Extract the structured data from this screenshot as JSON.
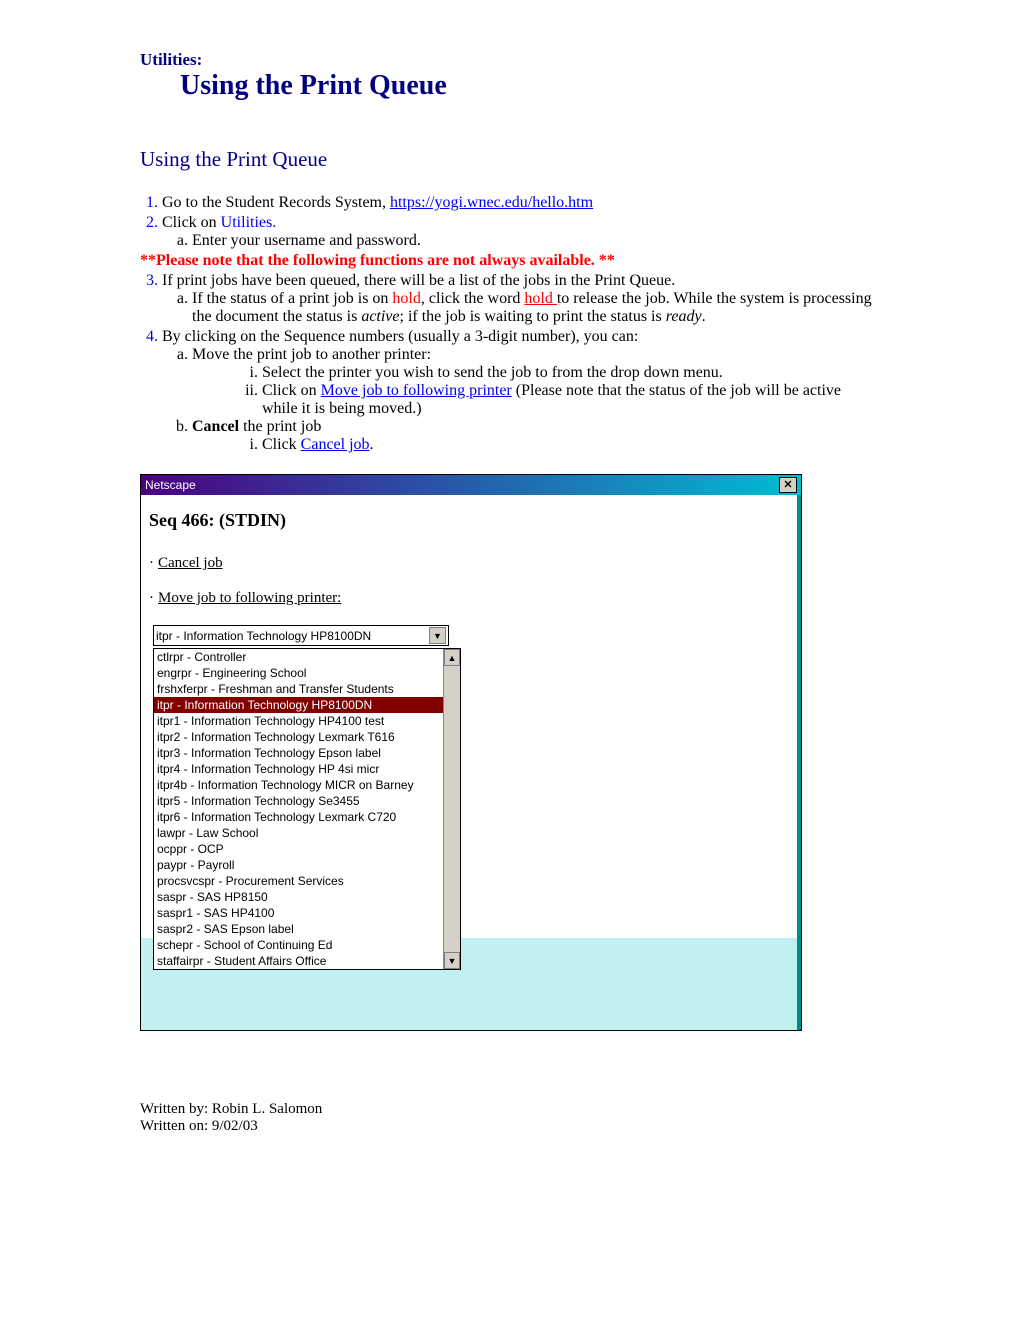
{
  "header": {
    "section_label": "Utilities:",
    "main_title": "Using the Print Queue",
    "subtitle": "Using the Print Queue"
  },
  "steps": {
    "s1_pre": "Go to the Student Records System, ",
    "s1_link": "https://yogi.wnec.edu/hello.htm",
    "s2_pre": "Click on ",
    "s2_link": "Utilities.",
    "s2a": "Enter your username and password.",
    "note": "**Please note that the following functions are not always available. **",
    "s3": "If print jobs have been queued, there will be a list of the jobs in the Print Queue.",
    "s3a_pre": "If the status of a print job is on ",
    "s3a_hold1": "hold",
    "s3a_mid": ", click the word ",
    "s3a_hold2": "hold ",
    "s3a_post1": "to release the job. While the system is processing the document the status is ",
    "s3a_italic1": "active",
    "s3a_post2": "; if the job is waiting to print the status is ",
    "s3a_italic2": "ready",
    "s3a_end": ".",
    "s4": "By clicking on the Sequence numbers (usually a 3-digit number), you can:",
    "s4a": "Move the print job to another printer:",
    "s4a_i": "Select the printer you wish to send the job to from the drop down menu.",
    "s4a_ii_pre": "Click on ",
    "s4a_ii_link": "Move job to following printer",
    "s4a_ii_post": " (Please note that the status of the job will be active while it is being moved.)",
    "s4b_bold": "Cancel",
    "s4b_post": " the print job",
    "s4b_i_pre": "Click ",
    "s4b_i_link": "Cancel job",
    "s4b_i_end": "."
  },
  "screenshot": {
    "titlebar": "Netscape",
    "seq": "Seq 466: (STDIN)",
    "cancel_link": "Cancel job",
    "move_link": "Move job to following printer:",
    "combo_selected": "itpr - Information Technology HP8100DN",
    "options": [
      "ctlrpr - Controller",
      "engrpr - Engineering School",
      "frshxferpr - Freshman and Transfer Students",
      "itpr - Information Technology HP8100DN",
      "itpr1 - Information Technology HP4100 test",
      "itpr2 - Information Technology Lexmark T616",
      "itpr3 - Information Technology Epson label",
      "itpr4 - Information Technology HP 4si micr",
      "itpr4b - Information Technology MICR on Barney",
      "itpr5 - Information Technology Se3455",
      "itpr6 - Information Technology Lexmark C720",
      "lawpr - Law School",
      "ocppr - OCP",
      "paypr - Payroll",
      "procsvcspr - Procurement Services",
      "saspr - SAS HP8150",
      "saspr1 - SAS HP4100",
      "saspr2 - SAS Epson label",
      "schepr - School of Continuing Ed",
      "staffairpr - Student Affairs Office"
    ],
    "selected_index": 3
  },
  "footer": {
    "by": "Written by: Robin L. Salomon",
    "on": "Written on: 9/02/03"
  }
}
